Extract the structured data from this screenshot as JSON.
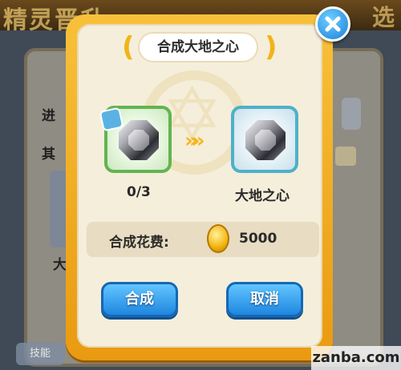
{
  "background": {
    "title": "精灵晋升",
    "title_right": "选",
    "left_labels": [
      "进",
      "其"
    ],
    "bottom_button": "技能",
    "card_glyph": "大"
  },
  "dialog": {
    "title": "合成大地之心",
    "ingredient": {
      "icon": "gray-gem-fragment",
      "count": "0/3"
    },
    "result": {
      "icon": "gray-gem",
      "name": "大地之心"
    },
    "cost": {
      "label": "合成花费:",
      "currency_icon": "gold-coin",
      "amount": "5000"
    },
    "buttons": {
      "compose": "合成",
      "cancel": "取消"
    }
  },
  "watermark": "zanba.com",
  "colors": {
    "dialog_frame": "#f3b027",
    "button_blue": "#2e96ea",
    "ingredient_border": "#63b450",
    "result_border": "#4fb0c9"
  }
}
